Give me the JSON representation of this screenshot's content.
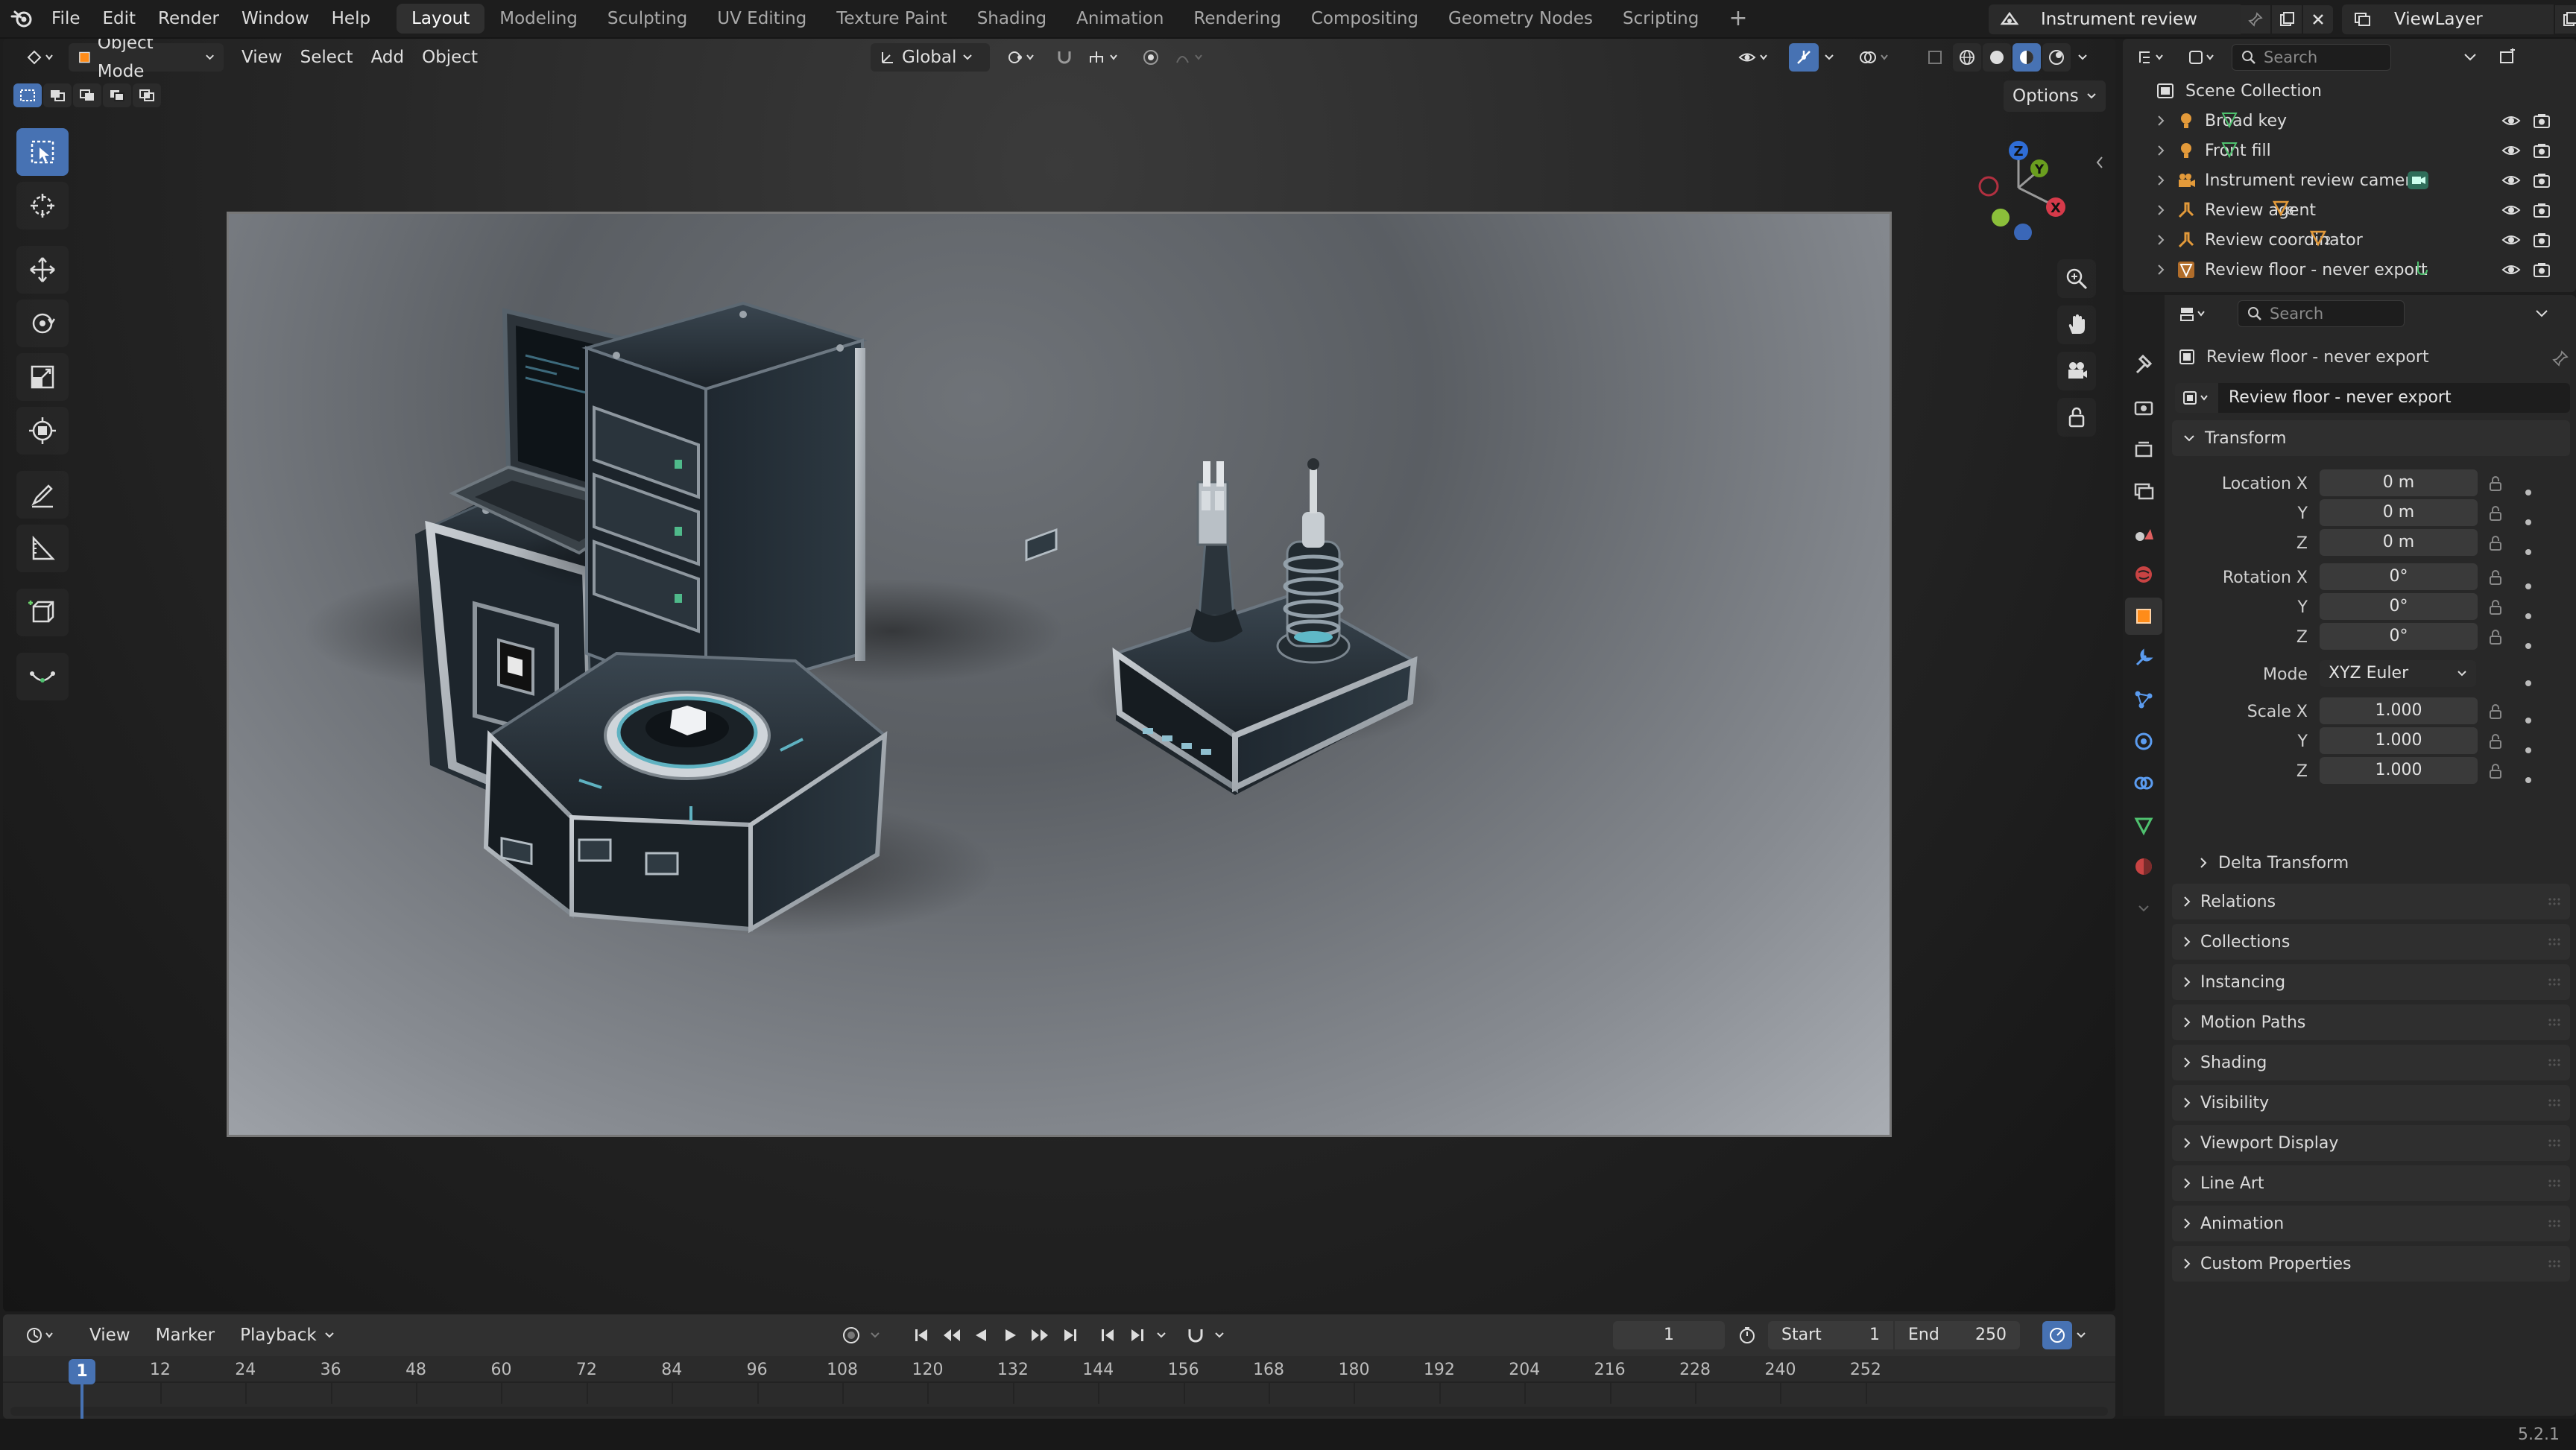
{
  "topbar": {
    "menus": [
      "File",
      "Edit",
      "Render",
      "Window",
      "Help"
    ],
    "workspaces": [
      "Layout",
      "Modeling",
      "Sculpting",
      "UV Editing",
      "Texture Paint",
      "Shading",
      "Animation",
      "Rendering",
      "Compositing",
      "Geometry Nodes",
      "Scripting"
    ],
    "active_workspace": "Layout",
    "add_workspace": "+",
    "scene_name": "Instrument review studio",
    "view_layer": "ViewLayer"
  },
  "viewport": {
    "mode": "Object Mode",
    "menus": [
      "View",
      "Select",
      "Add",
      "Object"
    ],
    "orientation": "Global",
    "options_label": "Options",
    "gizmo": {
      "x": "X",
      "y": "Y",
      "z": "Z"
    }
  },
  "outliner": {
    "search_placeholder": "Search",
    "root": "Scene Collection",
    "items": [
      {
        "name": "Broad key",
        "icon": "light-icon",
        "sub": ""
      },
      {
        "name": "Front fill",
        "icon": "light-icon",
        "sub": ""
      },
      {
        "name": "Instrument review camera",
        "icon": "camera-icon",
        "sub": ""
      },
      {
        "name": "Review agent",
        "icon": "armature-icon",
        "sub": "8"
      },
      {
        "name": "Review coordinator",
        "icon": "armature-icon",
        "sub": "2"
      },
      {
        "name": "Review floor - never export",
        "icon": "mesh-icon",
        "sub": ""
      }
    ]
  },
  "properties": {
    "search_placeholder": "Search",
    "object_name": "Review floor - never export",
    "datablock_name": "Review floor - never export",
    "transform_title": "Transform",
    "location_label": "Location X",
    "rotation_label": "Rotation X",
    "scale_label": "Scale X",
    "axis_y": "Y",
    "axis_z": "Z",
    "location": [
      "0 m",
      "0 m",
      "0 m"
    ],
    "rotation": [
      "0°",
      "0°",
      "0°"
    ],
    "mode_label": "Mode",
    "mode_value": "XYZ Euler",
    "scale": [
      "1.000",
      "1.000",
      "1.000"
    ],
    "delta_transform": "Delta Transform",
    "panels": [
      "Relations",
      "Collections",
      "Instancing",
      "Motion Paths",
      "Shading",
      "Visibility",
      "Viewport Display",
      "Line Art",
      "Animation",
      "Custom Properties"
    ]
  },
  "timeline": {
    "menus": [
      "View",
      "Marker",
      "Playback"
    ],
    "current_frame": "1",
    "start_label": "Start",
    "start": "1",
    "end_label": "End",
    "end": "250",
    "ruler": [
      "12",
      "24",
      "36",
      "48",
      "60",
      "72",
      "84",
      "96",
      "108",
      "120",
      "132",
      "144",
      "156",
      "168",
      "180",
      "192",
      "204",
      "216",
      "228",
      "240",
      "252"
    ],
    "playhead": "1"
  },
  "status": {
    "version": "5.2.1"
  },
  "colors": {
    "accent": "#4772b3",
    "active_tab": "#ff8c19"
  }
}
